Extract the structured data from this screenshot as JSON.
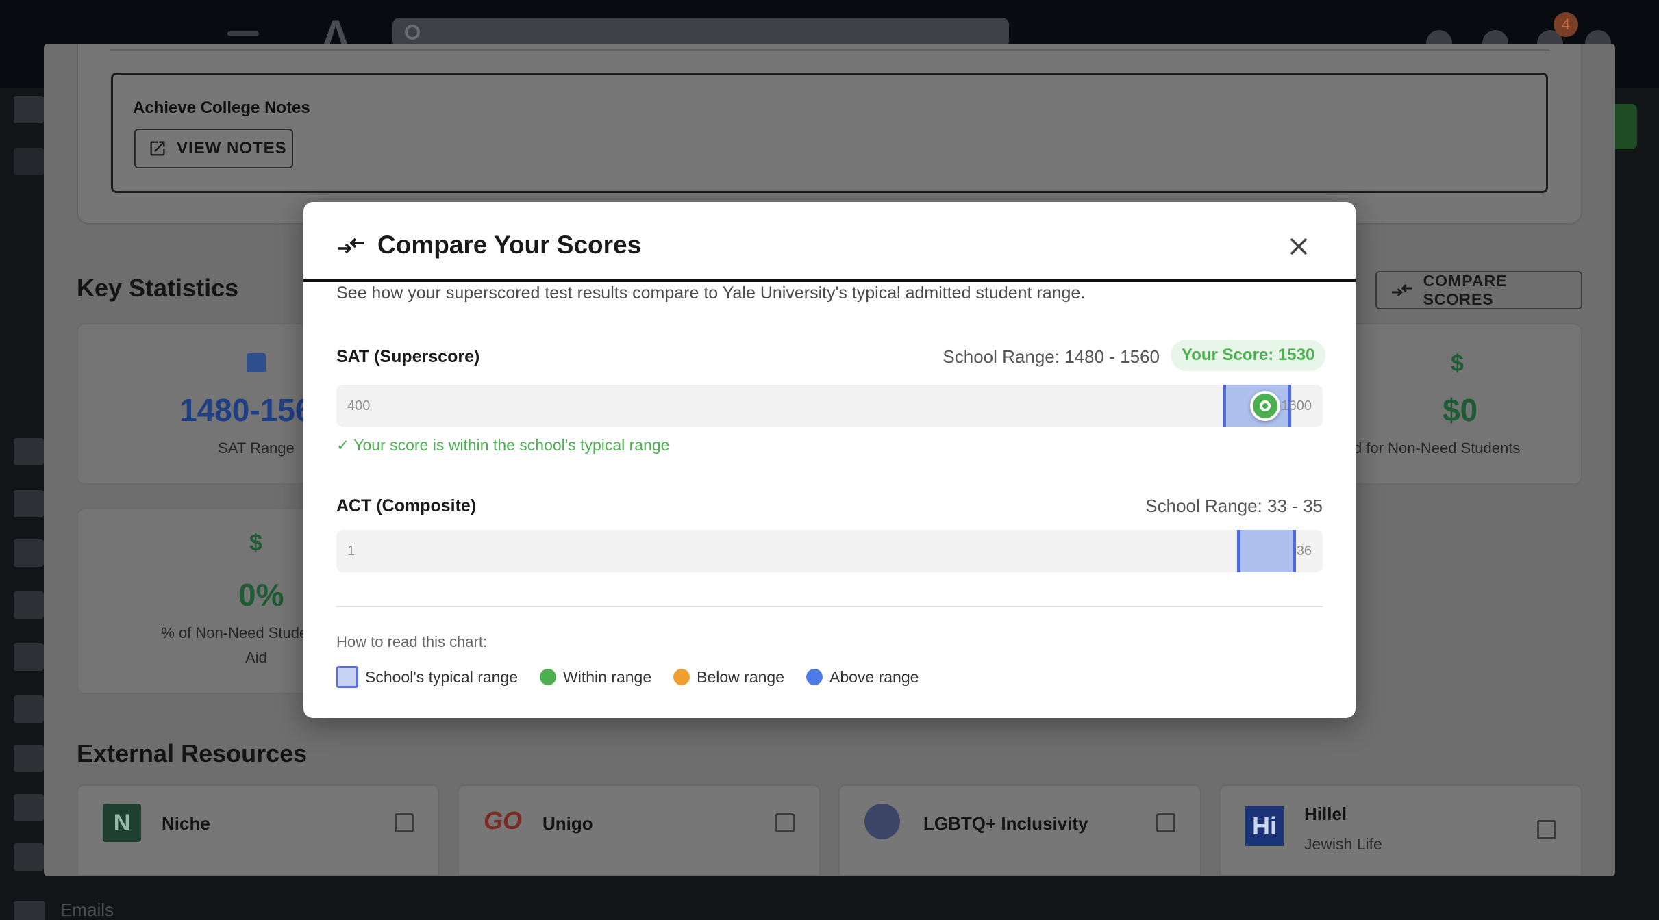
{
  "background": {
    "badge_count": "4",
    "notes": {
      "title": "Achieve College Notes",
      "view_notes_label": "VIEW NOTES"
    },
    "key_statistics": {
      "title": "Key Statistics",
      "compare_label": "COMPARE SCORES",
      "cards": [
        {
          "value": "1480-156",
          "label": "SAT Range",
          "icon": "bar-chart-icon"
        },
        {
          "value": "$0",
          "label": "d for Non-Need Students",
          "icon": "dollar-icon"
        },
        {
          "value": "0%",
          "label_line1": "% of Non-Need Students Re",
          "label_line2": "Aid",
          "icon": "dollar-icon"
        }
      ]
    },
    "external_resources": {
      "title": "External Resources",
      "items": [
        {
          "name": "Niche",
          "logo": "N"
        },
        {
          "name": "Unigo",
          "logo": "GO"
        },
        {
          "name": "LGBTQ+ Inclusivity",
          "logo": "globe"
        },
        {
          "name": "Hillel",
          "sub": "Jewish Life",
          "logo": "Hi"
        }
      ]
    },
    "sidebar": {
      "emails_label": "Emails"
    }
  },
  "modal": {
    "title": "Compare Your Scores",
    "description": "See how your superscored test results compare to Yale University's typical admitted student range.",
    "sat": {
      "label": "SAT (Superscore)",
      "range_text": "School Range: 1480 - 1560",
      "your_score_text": "Your Score: 1530",
      "min_label": "400",
      "max_label": "1600",
      "min": 400,
      "max": 1600,
      "range_low": 1480,
      "range_high": 1560,
      "score": 1530,
      "status_message": "✓ Your score is within the school's typical range"
    },
    "act": {
      "label": "ACT (Composite)",
      "range_text": "School Range: 33 - 35",
      "min_label": "1",
      "max_label": "36",
      "min": 1,
      "max": 36,
      "range_low": 33,
      "range_high": 35
    },
    "legend": {
      "title": "How to read this chart:",
      "items": [
        {
          "label": "School's typical range",
          "color": "#c7d2f5"
        },
        {
          "label": "Within range",
          "color": "#4caf50"
        },
        {
          "label": "Below range",
          "color": "#f0a030"
        },
        {
          "label": "Above range",
          "color": "#4a7be8"
        }
      ]
    }
  }
}
